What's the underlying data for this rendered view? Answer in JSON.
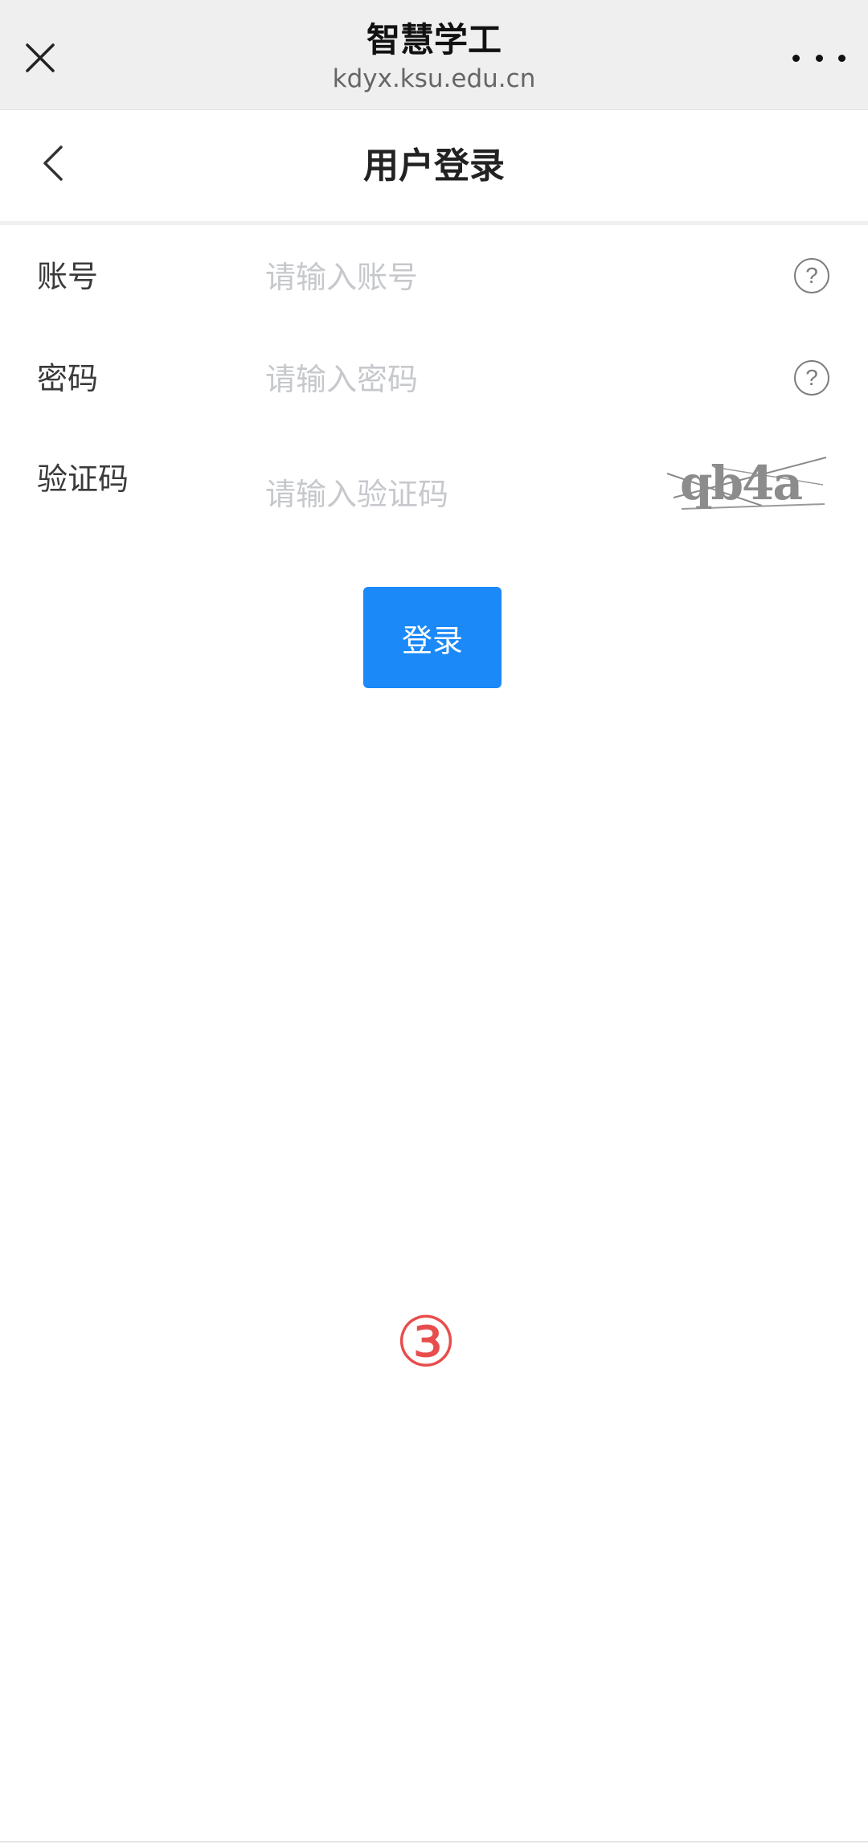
{
  "topbar": {
    "title": "智慧学工",
    "url": "kdyx.ksu.edu.cn",
    "close_icon": "close-icon",
    "more_icon": "more-horizontal-icon"
  },
  "header": {
    "title": "用户登录",
    "back_icon": "chevron-left-icon"
  },
  "form": {
    "account": {
      "label": "账号",
      "placeholder": "请输入账号",
      "value": "",
      "help_icon": "question-circle-icon",
      "help_text": "?"
    },
    "password": {
      "label": "密码",
      "placeholder": "请输入密码",
      "value": "",
      "help_icon": "question-circle-icon",
      "help_text": "?"
    },
    "captcha": {
      "label": "验证码",
      "placeholder": "请输入验证码",
      "value": "",
      "image_text": "qb4a"
    },
    "login_label": "登录"
  },
  "marker": {
    "text": "③",
    "color": "#e84d4d"
  },
  "colors": {
    "primary": "#1b89f8",
    "topbar_bg": "#efefef",
    "placeholder": "#c6c8cc"
  }
}
